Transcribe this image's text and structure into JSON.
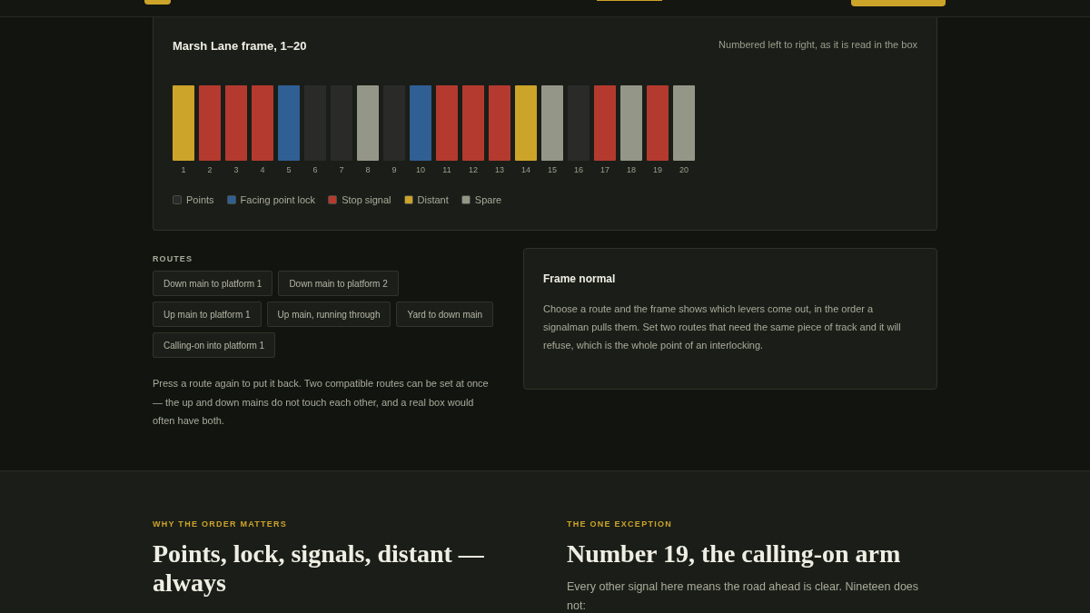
{
  "frame": {
    "title": "Marsh Lane frame, 1–20",
    "note": "Numbered left to right, as it is read in the box",
    "levers": [
      {
        "number": "1",
        "kind": "distant"
      },
      {
        "number": "2",
        "kind": "stop"
      },
      {
        "number": "3",
        "kind": "stop"
      },
      {
        "number": "4",
        "kind": "stop"
      },
      {
        "number": "5",
        "kind": "lock"
      },
      {
        "number": "6",
        "kind": "points"
      },
      {
        "number": "7",
        "kind": "points"
      },
      {
        "number": "8",
        "kind": "spare"
      },
      {
        "number": "9",
        "kind": "points"
      },
      {
        "number": "10",
        "kind": "lock"
      },
      {
        "number": "11",
        "kind": "stop"
      },
      {
        "number": "12",
        "kind": "stop"
      },
      {
        "number": "13",
        "kind": "stop"
      },
      {
        "number": "14",
        "kind": "distant"
      },
      {
        "number": "15",
        "kind": "spare"
      },
      {
        "number": "16",
        "kind": "points"
      },
      {
        "number": "17",
        "kind": "stop"
      },
      {
        "number": "18",
        "kind": "spare"
      },
      {
        "number": "19",
        "kind": "stop"
      },
      {
        "number": "20",
        "kind": "spare"
      }
    ],
    "legend": [
      {
        "kind": "points",
        "label": "Points",
        "color": "#2a2b29"
      },
      {
        "kind": "lock",
        "label": "Facing point lock",
        "color": "#2f5f93"
      },
      {
        "kind": "stop",
        "label": "Stop signal",
        "color": "#b43a2f"
      },
      {
        "kind": "distant",
        "label": "Distant",
        "color": "#cda42a"
      },
      {
        "kind": "spare",
        "label": "Spare",
        "color": "#949687"
      }
    ]
  },
  "routes": {
    "heading": "ROUTES",
    "items": [
      {
        "label": "Down main to platform 1",
        "selected": false
      },
      {
        "label": "Down main to platform 2",
        "selected": false
      },
      {
        "label": "Up main to platform 1",
        "selected": false
      },
      {
        "label": "Up main, running through",
        "selected": false
      },
      {
        "label": "Yard to down main",
        "selected": false
      },
      {
        "label": "Calling-on into platform 1",
        "selected": false
      }
    ],
    "hint": "Press a route again to put it back. Two compatible routes can be set at once — the up and down mains do not touch each other, and a real box would often have both."
  },
  "status": {
    "title": "Frame normal",
    "text": "Choose a route and the frame shows which levers come out, in the order a signalman pulls them. Set two routes that need the same piece of track and it will refuse, which is the whole point of an interlocking."
  },
  "sections": [
    {
      "eyebrow": "WHY THE ORDER MATTERS",
      "heading": "Points, lock, signals, distant — always"
    },
    {
      "eyebrow": "THE ONE EXCEPTION",
      "heading": "Number 19, the calling-on arm",
      "text": "Every other signal here means the road ahead is clear. Nineteen does not:"
    }
  ]
}
